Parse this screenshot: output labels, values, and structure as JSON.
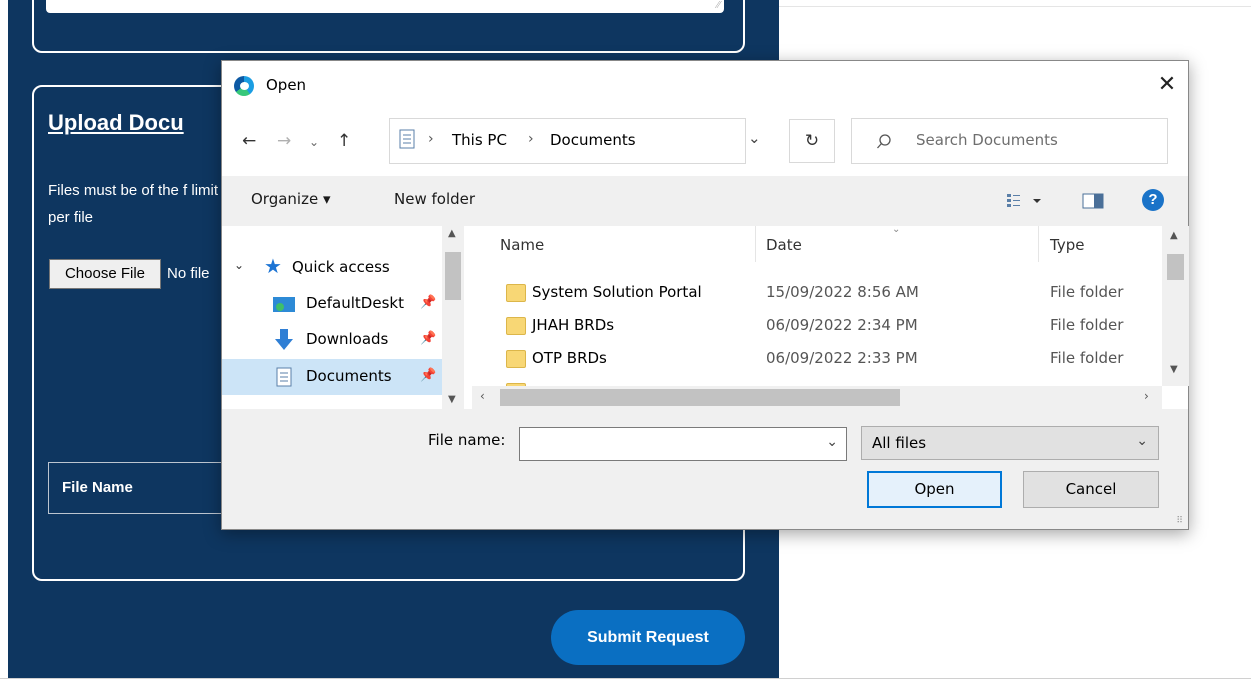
{
  "background_form": {
    "upload_title": "Upload Docu",
    "description": "Files must be of the f limit per file",
    "choose_file_label": "Choose File",
    "no_file_text": "No file",
    "table_header_file_name": "File Name",
    "submit_label": "Submit Request",
    "colors": {
      "panel": "#0e3660",
      "submit": "#0a6fc2"
    }
  },
  "dialog": {
    "title": "Open",
    "address": {
      "segments": [
        "This PC",
        "Documents"
      ]
    },
    "search_placeholder": "Search Documents",
    "toolbar": {
      "organize_label": "Organize ▾",
      "new_folder_label": "New folder"
    },
    "nav_items": [
      {
        "label": "Quick access",
        "icon": "star-icon",
        "selected": false
      },
      {
        "label": "DefaultDeskt",
        "icon": "desktop-icon",
        "selected": false
      },
      {
        "label": "Downloads",
        "icon": "download-arrow-icon",
        "selected": false
      },
      {
        "label": "Documents",
        "icon": "document-icon",
        "selected": true
      }
    ],
    "columns": {
      "name": "Name",
      "date": "Date",
      "type": "Type"
    },
    "files": [
      {
        "name": "System Solution Portal",
        "date": "15/09/2022 8:56 AM",
        "type": "File folder"
      },
      {
        "name": "JHAH BRDs",
        "date": "06/09/2022 2:34 PM",
        "type": "File folder"
      },
      {
        "name": "OTP BRDs",
        "date": "06/09/2022 2:33 PM",
        "type": "File folder"
      }
    ],
    "file_name_label": "File name:",
    "file_name_value": "",
    "file_type_value": "All files",
    "open_label": "Open",
    "cancel_label": "Cancel",
    "accent_color": "#0078d7"
  }
}
